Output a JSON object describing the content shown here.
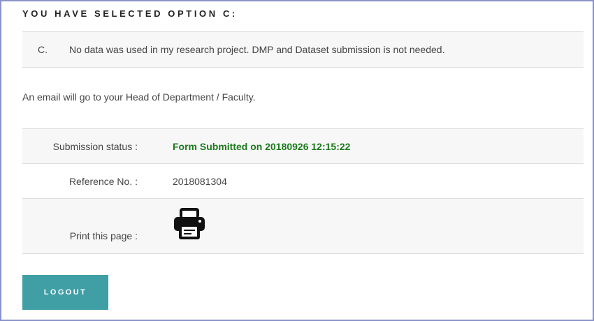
{
  "heading": "YOU HAVE SELECTED OPTION C:",
  "option": {
    "letter": "C.",
    "text": "No data was used in my research project. DMP and Dataset submission is not needed."
  },
  "email_note": "An email will go to your Head of Department / Faculty.",
  "info": {
    "status_label": "Submission status :",
    "status_value": "Form Submitted on 20180926 12:15:22",
    "reference_label": "Reference No. :",
    "reference_value": "2018081304",
    "print_label": "Print this page :",
    "print_icon": "printer-icon"
  },
  "logout_label": "LOGOUT",
  "colors": {
    "border": "#8a93c9",
    "status_text": "#1a7a1a",
    "logout_button": "#3f9fa5",
    "row_shade": "#f7f7f7"
  }
}
